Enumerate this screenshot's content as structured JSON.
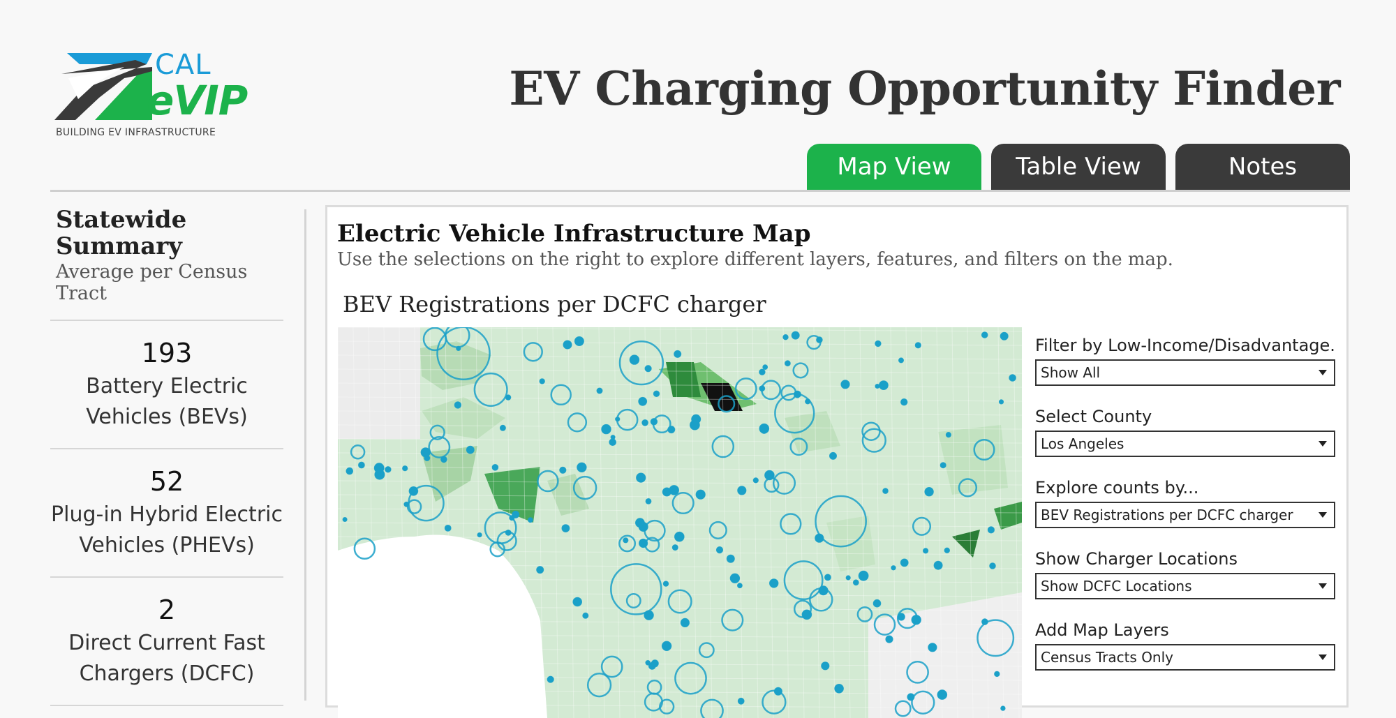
{
  "logo": {
    "cal": "CAL",
    "evip": "eVIP",
    "tagline": "BUILDING EV INFRASTRUCTURE"
  },
  "app_title": "EV Charging Opportunity Finder",
  "tabs": [
    {
      "label": "Map View",
      "active": true
    },
    {
      "label": "Table View",
      "active": false
    },
    {
      "label": "Notes",
      "active": false
    }
  ],
  "sidebar": {
    "title": "Statewide Summary",
    "subtitle": "Average per Census Tract",
    "stats": [
      {
        "value": "193",
        "label": "Battery Electric Vehicles (BEVs)"
      },
      {
        "value": "52",
        "label": "Plug-in Hybrid Electric Vehicles (PHEVs)"
      },
      {
        "value": "2",
        "label": "Direct Current Fast Chargers (DCFC)"
      }
    ]
  },
  "panel": {
    "title": "Electric Vehicle Infrastructure Map",
    "subtitle": "Use the selections on the right to explore different layers, features, and filters on the map.",
    "map_title": "BEV Registrations per DCFC charger"
  },
  "filters": [
    {
      "label": "Filter by Low-Income/Disadvantage...",
      "value": "Show All"
    },
    {
      "label": "Select County",
      "value": "Los Angeles"
    },
    {
      "label": "Explore counts by...",
      "value": "BEV Registrations per DCFC charger"
    },
    {
      "label": "Show Charger Locations",
      "value": "Show DCFC Locations"
    },
    {
      "label": "Add Map Layers",
      "value": "Census Tracts Only"
    }
  ],
  "colors": {
    "brand_green": "#1cb24b",
    "brand_blue": "#1a9bd7",
    "tab_dark": "#3a3a3a",
    "marker": "#1aa0c8"
  }
}
